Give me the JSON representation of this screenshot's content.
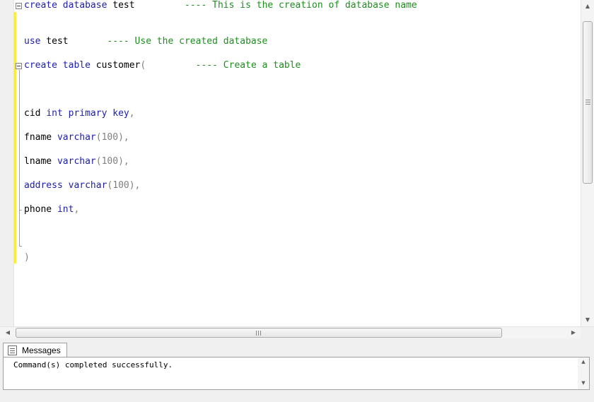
{
  "editor": {
    "lines": [
      {
        "row": 0,
        "tokens": [
          {
            "t": "create",
            "c": "kw"
          },
          {
            "t": " ",
            "c": "nm"
          },
          {
            "t": "database",
            "c": "kw"
          },
          {
            "t": " test         ",
            "c": "nm"
          },
          {
            "t": "---- This is the creation of database name",
            "c": "cm"
          }
        ]
      },
      {
        "row": 3,
        "tokens": [
          {
            "t": "use",
            "c": "kw"
          },
          {
            "t": " test       ",
            "c": "nm"
          },
          {
            "t": "---- Use the created database",
            "c": "cm"
          }
        ]
      },
      {
        "row": 5,
        "tokens": [
          {
            "t": "create",
            "c": "kw"
          },
          {
            "t": " ",
            "c": "nm"
          },
          {
            "t": "table",
            "c": "kw"
          },
          {
            "t": " customer",
            "c": "nm"
          },
          {
            "t": "(",
            "c": "pn"
          },
          {
            "t": "         ",
            "c": "nm"
          },
          {
            "t": "---- Create a table",
            "c": "cm"
          }
        ]
      },
      {
        "row": 9,
        "tokens": [
          {
            "t": "cid ",
            "c": "nm"
          },
          {
            "t": "int",
            "c": "kw"
          },
          {
            "t": " ",
            "c": "nm"
          },
          {
            "t": "primary key",
            "c": "kw"
          },
          {
            "t": ",",
            "c": "pn"
          }
        ]
      },
      {
        "row": 11,
        "tokens": [
          {
            "t": "fname ",
            "c": "nm"
          },
          {
            "t": "varchar",
            "c": "kw"
          },
          {
            "t": "(100),",
            "c": "pn"
          }
        ]
      },
      {
        "row": 13,
        "tokens": [
          {
            "t": "lname ",
            "c": "nm"
          },
          {
            "t": "varchar",
            "c": "kw"
          },
          {
            "t": "(100),",
            "c": "pn"
          }
        ]
      },
      {
        "row": 15,
        "tokens": [
          {
            "t": "address",
            "c": "kw"
          },
          {
            "t": " ",
            "c": "nm"
          },
          {
            "t": "varchar",
            "c": "kw"
          },
          {
            "t": "(100),",
            "c": "pn"
          }
        ]
      },
      {
        "row": 17,
        "tokens": [
          {
            "t": "phone ",
            "c": "nm"
          },
          {
            "t": "int",
            "c": "kw"
          },
          {
            "t": ",",
            "c": "pn"
          }
        ]
      },
      {
        "row": 21,
        "tokens": [
          {
            "t": ")",
            "c": "pn"
          }
        ]
      }
    ]
  },
  "scrollbars": {
    "vertical_up_icon": "triangle-up-icon",
    "vertical_down_icon": "triangle-down-icon",
    "horizontal_left_icon": "triangle-left-icon",
    "horizontal_right_icon": "triangle-right-icon",
    "arrow_up": "▲",
    "arrow_down": "▼",
    "arrow_left": "◀",
    "arrow_right": "▶"
  },
  "results": {
    "tab_label": "Messages",
    "tab_icon": "messages-icon",
    "message": "Command(s) completed successfully."
  },
  "colors": {
    "keyword": "#1d1db0",
    "comment": "#1e8e1e",
    "change_marker": "#ffeb3b"
  }
}
